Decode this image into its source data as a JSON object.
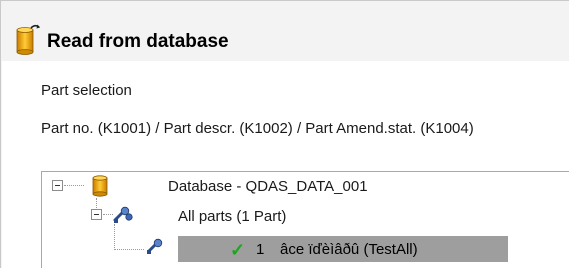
{
  "header": {
    "title": "Read from database",
    "icon": "database-arrow-icon"
  },
  "selection": {
    "label": "Part selection",
    "keys_text": "Part no. (K1001) / Part descr. (K1002) / Part Amend.stat. (K1004)"
  },
  "tree": {
    "database_label": "Database - QDAS_DATA_001",
    "all_parts_label": "All parts (1 Part)",
    "part": {
      "number": "1",
      "name": "âce ïďèìâðû (TestAll)",
      "status_icon": "checkmark-icon"
    }
  },
  "colors": {
    "db_icon": "#e8a512",
    "selection_bg": "#9e9e9e",
    "check": "#1aa81a"
  }
}
